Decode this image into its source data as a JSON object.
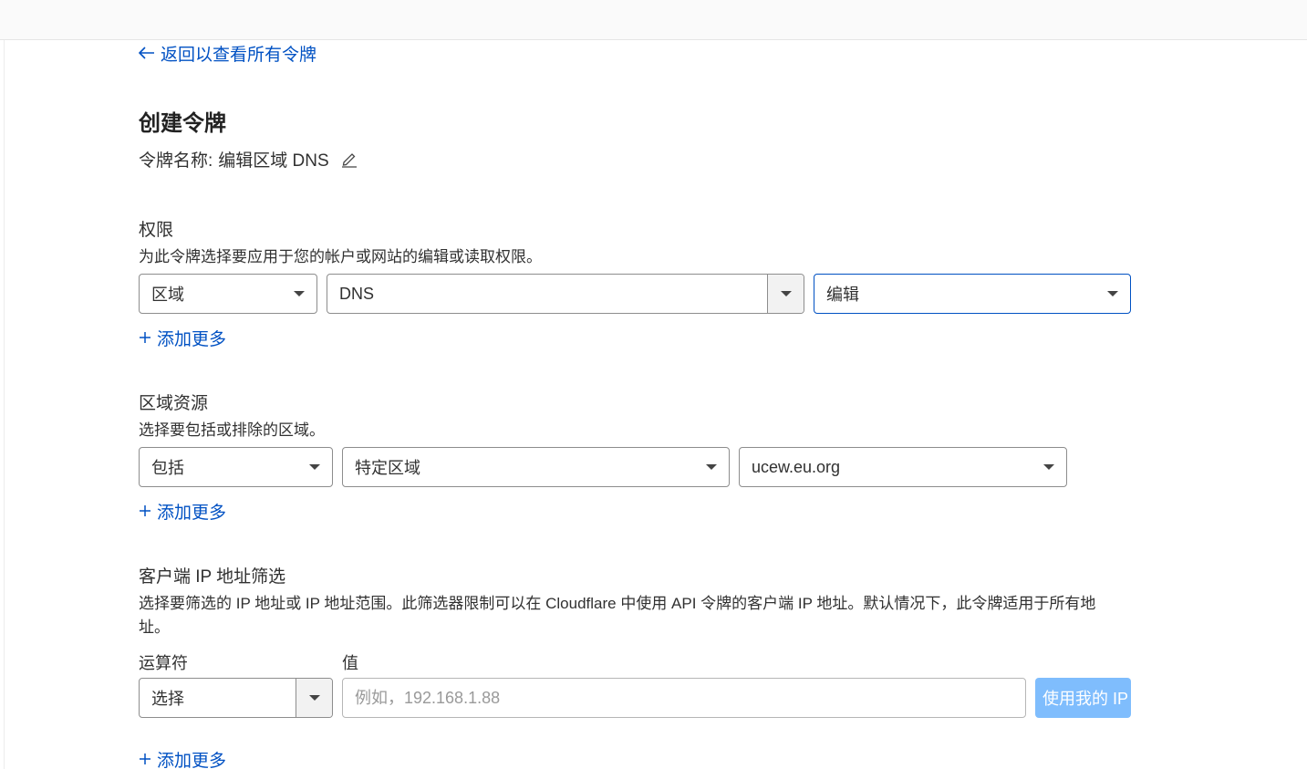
{
  "back_link": "返回以查看所有令牌",
  "page_title": "创建令牌",
  "token_name": {
    "label": "令牌名称:",
    "value": "编辑区域 DNS"
  },
  "permissions": {
    "title": "权限",
    "description": "为此令牌选择要应用于您的帐户或网站的编辑或读取权限。",
    "scope": "区域",
    "resource": "DNS",
    "level": "编辑",
    "add_more": "添加更多"
  },
  "zone_resources": {
    "title": "区域资源",
    "description": "选择要包括或排除的区域。",
    "include": "包括",
    "type": "特定区域",
    "zone": "ucew.eu.org",
    "add_more": "添加更多"
  },
  "ip_filter": {
    "title": "客户端 IP 地址筛选",
    "description": "选择要筛选的 IP 地址或 IP 地址范围。此筛选器限制可以在 Cloudflare 中使用 API 令牌的客户端 IP 地址。默认情况下，此令牌适用于所有地址。",
    "operator_label": "运算符",
    "value_label": "值",
    "operator": "选择",
    "value_placeholder": "例如，192.168.1.88",
    "use_my_ip": "使用我的 IP",
    "add_more": "添加更多"
  },
  "colors": {
    "link": "#0051c3",
    "focus_border": "#0051c3",
    "disabled_button": "#7fbdfd"
  }
}
